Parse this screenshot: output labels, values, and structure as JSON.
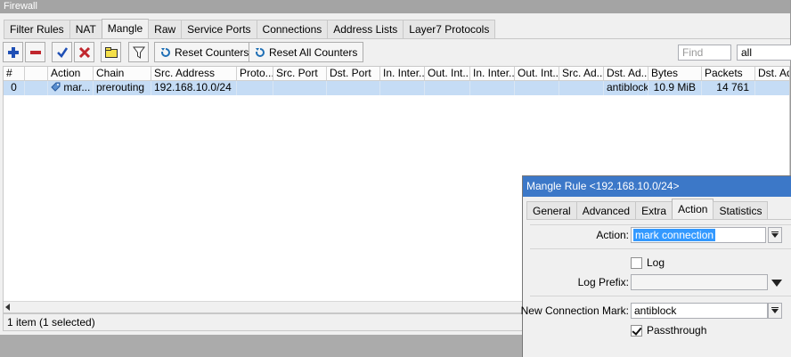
{
  "window": {
    "title": "Firewall"
  },
  "tabs": [
    {
      "label": "Filter Rules",
      "active": false
    },
    {
      "label": "NAT",
      "active": false
    },
    {
      "label": "Mangle",
      "active": true
    },
    {
      "label": "Raw",
      "active": false
    },
    {
      "label": "Service Ports",
      "active": false
    },
    {
      "label": "Connections",
      "active": false
    },
    {
      "label": "Address Lists",
      "active": false
    },
    {
      "label": "Layer7 Protocols",
      "active": false
    }
  ],
  "toolbar": {
    "icons": [
      "add-icon",
      "remove-icon",
      "enable-icon",
      "disable-icon",
      "comment-icon",
      "filter-icon"
    ],
    "reset_counters_label": "Reset Counters",
    "reset_all_counters_label": "Reset All Counters",
    "find_placeholder": "Find",
    "filter_value": "all"
  },
  "table": {
    "columns": [
      "#",
      "",
      "Action",
      "Chain",
      "Src. Address",
      "Proto...",
      "Src. Port",
      "Dst. Port",
      "In. Inter...",
      "Out. Int...",
      "In. Inter...",
      "Out. Int...",
      "Src. Ad...",
      "Dst. Ad...",
      "Bytes",
      "Packets",
      "Dst. Add"
    ],
    "rows": [
      {
        "num": "0",
        "flag": "",
        "action": "mar...",
        "chain": "prerouting",
        "src_address": "192.168.10.0/24",
        "protocol": "",
        "src_port": "",
        "dst_port": "",
        "in_interface": "",
        "out_interface": "",
        "in_interface_list": "",
        "out_interface_list": "",
        "src_address_list": "",
        "dst_address_list": "antiblock",
        "bytes": "10.9 MiB",
        "packets": "14 761",
        "dst_address": ""
      }
    ]
  },
  "status": {
    "text": "1 item (1 selected)"
  },
  "dialog": {
    "title": "Mangle Rule <192.168.10.0/24>",
    "tabs": [
      {
        "label": "General",
        "active": false
      },
      {
        "label": "Advanced",
        "active": false
      },
      {
        "label": "Extra",
        "active": false
      },
      {
        "label": "Action",
        "active": true
      },
      {
        "label": "Statistics",
        "active": false
      }
    ],
    "action_label": "Action:",
    "action_value": "mark connection",
    "log_label": "Log",
    "log_checked": false,
    "log_prefix_label": "Log Prefix:",
    "log_prefix_value": "",
    "new_connection_mark_label": "New Connection Mark:",
    "new_connection_mark_value": "antiblock",
    "passthrough_label": "Passthrough",
    "passthrough_checked": true
  },
  "colors": {
    "selected_row": "#c5dcf5",
    "dialog_title_bg": "#3c78c8",
    "add_icon": "#1f4fb5",
    "remove_icon": "#c0262d"
  }
}
